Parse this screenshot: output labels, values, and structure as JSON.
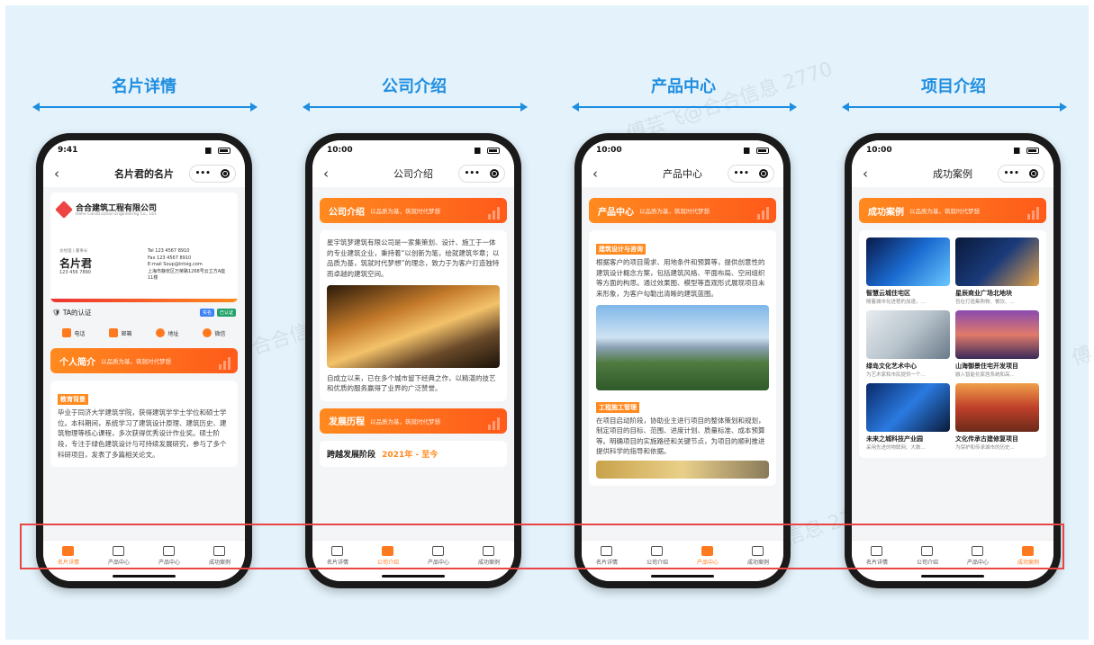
{
  "watermark": "傅芸飞@合合信息 2770",
  "watermark_short": "傅",
  "columns": [
    {
      "title": "名片详情"
    },
    {
      "title": "公司介绍"
    },
    {
      "title": "产品中心"
    },
    {
      "title": "项目介绍"
    }
  ],
  "tabs": [
    "名片详情",
    "产品中心",
    "产品中心",
    "成功案例"
  ],
  "tabs_std": [
    "名片详情",
    "公司介绍",
    "产品中心",
    "成功案例"
  ],
  "phone1": {
    "time": "9:41",
    "nav_title": "名片君的名片",
    "company": "合合建筑工程有限公司",
    "company_en": "Hehe Construction Engineering Co., Ltd.",
    "role": "总经理 | 董事长",
    "name": "名片君",
    "phone": "123 456 7890",
    "contact": [
      "Tel 123 4567 8910",
      "Fax 123 4567 8910",
      "E-mail Soup@intsig.com",
      "上海市静安区万荣路1268号云立方A座11楼"
    ],
    "verify": "TA的认证",
    "badge1": "实名",
    "badge2": "已认证",
    "actions": [
      "电话",
      "邮箱",
      "地址",
      "微信"
    ],
    "banner_title": "个人简介",
    "banner_sub": "以品质为基，筑就时代梦想",
    "tag": "教育背景",
    "text": "毕业于同济大学建筑学院，获得建筑学学士学位和硕士学位。本科期间，系统学习了建筑设计原理、建筑历史、建筑物理等核心课程，多次获得优秀设计作业奖。硕士阶段，专注于绿色建筑设计与可持续发展研究，参与了多个科研项目，发表了多篇相关论文。"
  },
  "phone2": {
    "time": "10:00",
    "nav_title": "公司介绍",
    "banner_title": "公司介绍",
    "banner_sub": "以品质为基，筑就时代梦想",
    "text1": "星宇筑梦建筑有限公司是一家集策划、设计、施工于一体的专业建筑企业，秉持着“以创新为笔，绘就建筑华章；以品质为基，筑就时代梦想”的理念，致力于为客户打造独特而卓越的建筑空间。",
    "text2": "自成立以来，已在多个城市留下经典之作，以精湛的技艺和优质的服务赢得了业界的广泛赞誉。",
    "banner2_title": "发展历程",
    "stage_label": "跨越发展阶段",
    "stage_year": "2021年 - 至今"
  },
  "phone3": {
    "time": "10:00",
    "nav_title": "产品中心",
    "banner_title": "产品中心",
    "banner_sub": "以品质为基，筑就时代梦想",
    "tag1": "建筑设计与咨询",
    "text1": "根据客户的项目需求、用地条件和预算等，提供创意性的建筑设计概念方案，包括建筑风格、平面布局、空间组织等方面的构思。通过效果图、模型等直观形式展现项目未来形象，为客户勾勒出清晰的建筑蓝图。",
    "tag2": "工程施工管理",
    "text2": "在项目启动阶段，协助业主进行项目的整体策划和规划，制定项目的目标、范围、进度计划、质量标准、成本预算等。明确项目的实施路径和关键节点，为项目的顺利推进提供科学的指导和依据。"
  },
  "phone4": {
    "time": "10:00",
    "nav_title": "成功案例",
    "banner_title": "成功案例",
    "banner_sub": "以品质为基，筑就时代梦想",
    "cases": [
      {
        "title": "智慧云城住宅区",
        "desc": "随着城市化进程的加速，..."
      },
      {
        "title": "星辰商业广场北地块",
        "desc": "旨在打造集购物、餐饮、..."
      },
      {
        "title": "绿岛文化艺术中心",
        "desc": "为艺术家和市民提供一个..."
      },
      {
        "title": "山海御景住宅开发项目",
        "desc": "融入智能化家居系统和高..."
      },
      {
        "title": "未来之城科技产业园",
        "desc": "采用先进的物联网、大数..."
      },
      {
        "title": "文化传承古建修复项目",
        "desc": "为保护和传承城市的历史..."
      }
    ]
  },
  "colors": {
    "accent": "#1f8ee0",
    "orange": "#ff7a1f",
    "highlight": "#e94545"
  }
}
